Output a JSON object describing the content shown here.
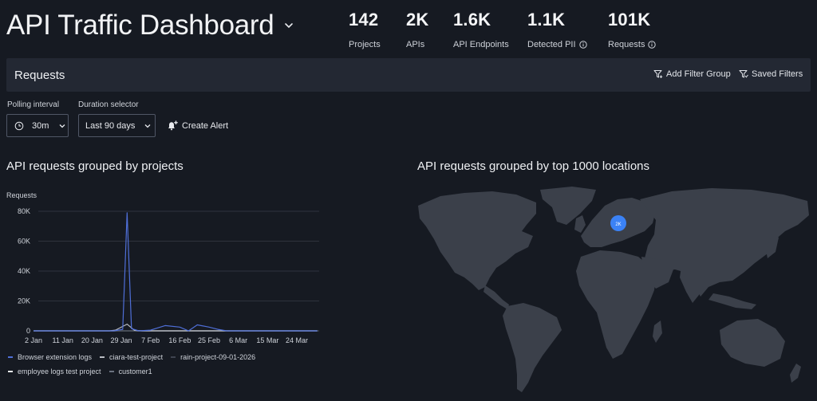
{
  "header": {
    "title": "API Traffic Dashboard",
    "stats": [
      {
        "value": "142",
        "label": "Projects",
        "info": false
      },
      {
        "value": "2K",
        "label": "APIs",
        "info": false
      },
      {
        "value": "1.6K",
        "label": "API Endpoints",
        "info": false
      },
      {
        "value": "1.1K",
        "label": "Detected PII",
        "info": true
      },
      {
        "value": "101K",
        "label": "Requests",
        "info": true
      }
    ]
  },
  "requests_bar": {
    "title": "Requests",
    "add_filter_group": "Add Filter Group",
    "saved_filters": "Saved Filters"
  },
  "controls": {
    "polling_label": "Polling interval",
    "polling_value": "30m",
    "duration_label": "Duration selector",
    "duration_value": "Last 90 days",
    "create_alert": "Create Alert"
  },
  "projects_chart": {
    "title": "API requests grouped by projects"
  },
  "locations_map": {
    "title": "API requests grouped by top 1000 locations",
    "marker_label": "2K"
  },
  "colors": {
    "accent": "#3b82f6",
    "series_blue": "#4f6fd8",
    "background": "#161a22",
    "panel": "#232833",
    "land": "#3b404a"
  },
  "chart_data": {
    "type": "line",
    "ylabel": "Requests",
    "ylim": [
      0,
      80000
    ],
    "yticks": [
      0,
      20000,
      40000,
      60000,
      80000
    ],
    "ytick_labels": [
      "0",
      "20K",
      "40K",
      "60K",
      "80K"
    ],
    "x_tick_labels": [
      "2 Jan",
      "11 Jan",
      "20 Jan",
      "29 Jan",
      "7 Feb",
      "16 Feb",
      "25 Feb",
      "6 Mar",
      "15 Mar",
      "24 Mar"
    ],
    "x_range": [
      0,
      9.7
    ],
    "grid": true,
    "series": [
      {
        "name": "Browser extension logs",
        "color": "#4f6fd8",
        "points": [
          [
            0,
            0
          ],
          [
            1,
            0
          ],
          [
            2,
            0
          ],
          [
            2.75,
            0
          ],
          [
            3.05,
            1000
          ],
          [
            3.2,
            79000
          ],
          [
            3.35,
            1500
          ],
          [
            3.6,
            0
          ],
          [
            4,
            500
          ],
          [
            4.5,
            3500
          ],
          [
            5,
            2500
          ],
          [
            5.3,
            0
          ],
          [
            5.6,
            4000
          ],
          [
            6,
            2500
          ],
          [
            6.3,
            1000
          ],
          [
            6.6,
            0
          ],
          [
            7,
            0
          ],
          [
            8,
            0
          ],
          [
            9,
            0
          ],
          [
            9.7,
            0
          ]
        ]
      },
      {
        "name": "ciara-test-project",
        "color": "#b9bcc3",
        "points": [
          [
            0,
            0
          ],
          [
            2.6,
            0
          ],
          [
            2.8,
            500
          ],
          [
            3.2,
            4500
          ],
          [
            3.45,
            300
          ],
          [
            3.7,
            0
          ],
          [
            9.7,
            0
          ]
        ]
      },
      {
        "name": "rain-project-09-01-2026",
        "color": "#3f4450",
        "points": [
          [
            0,
            0
          ],
          [
            9.7,
            0
          ]
        ]
      },
      {
        "name": "employee logs test project",
        "color": "#e8eaee",
        "points": [
          [
            0,
            0
          ],
          [
            9.7,
            0
          ]
        ]
      },
      {
        "name": "customer1",
        "color": "#6b7280",
        "points": [
          [
            0,
            0
          ],
          [
            9.7,
            0
          ]
        ]
      }
    ]
  }
}
